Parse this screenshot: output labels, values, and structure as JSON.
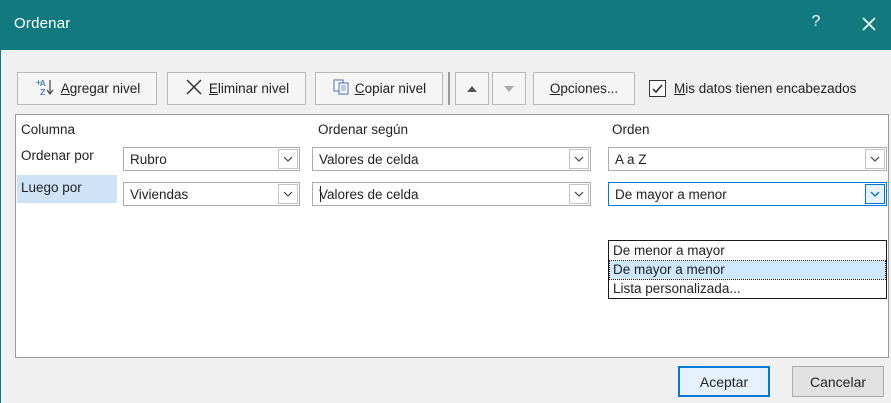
{
  "window": {
    "title": "Ordenar",
    "help": "?"
  },
  "toolbar": {
    "add_level": {
      "prefix": "A",
      "rest": "gregar nivel"
    },
    "delete_level": {
      "prefix": "E",
      "rest": "liminar nivel"
    },
    "copy_level": {
      "prefix": "C",
      "rest": "opiar nivel"
    },
    "options": {
      "prefix": "O",
      "rest": "pciones..."
    },
    "has_headers": {
      "prefix": "M",
      "rest": "is datos tienen encabezados",
      "checked": true
    }
  },
  "grid": {
    "columns": [
      "Columna",
      "Ordenar según",
      "Orden"
    ],
    "rows": [
      {
        "label": "Ordenar por",
        "column": "Rubro",
        "sort_on": "Valores de celda",
        "order": "A a Z"
      },
      {
        "label": "Luego por",
        "column": "Viviendas",
        "sort_on": "Valores de celda",
        "order": "De mayor a menor"
      }
    ]
  },
  "order_dropdown": {
    "options": [
      "De menor a mayor",
      "De mayor a menor",
      "Lista personalizada..."
    ],
    "highlighted_index": 1
  },
  "footer": {
    "ok": "Aceptar",
    "cancel": "Cancelar"
  },
  "colors": {
    "titlebar": "#127a7e",
    "accent": "#0078d7",
    "highlight": "#cde8ff"
  }
}
